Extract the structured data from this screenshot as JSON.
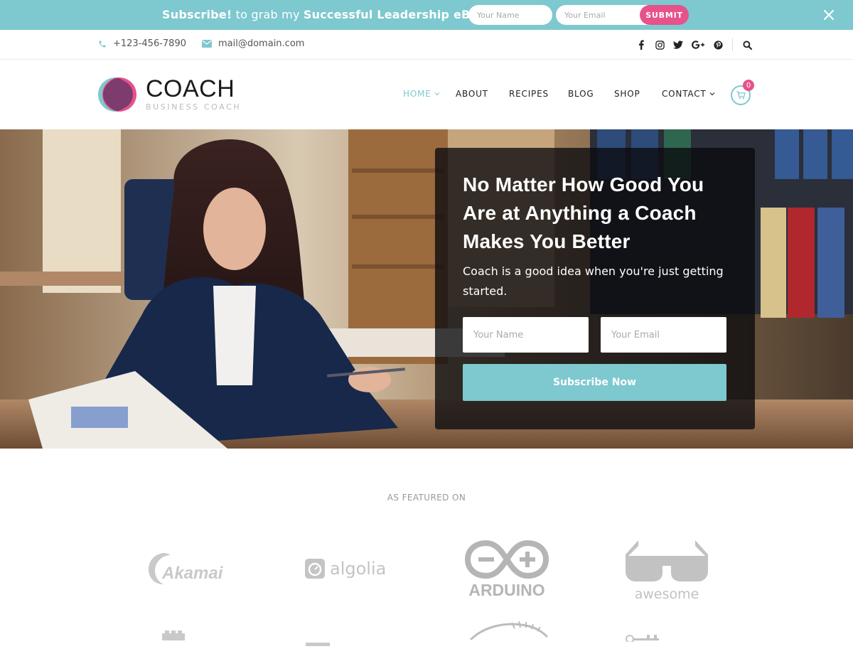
{
  "notify": {
    "text_strong_1": "Subscribe!",
    "text_mid": " to grab my ",
    "text_strong_2": "Successful Leadership eBook!",
    "name_placeholder": "Your Name",
    "email_placeholder": "Your Email",
    "submit_label": "SUBMIT",
    "close_icon": "close-icon",
    "bg_color": "#7ec8cf",
    "submit_color": "#e7528a"
  },
  "contact": {
    "phone": "+123-456-7890",
    "email": "mail@domain.com",
    "social_icons": [
      "facebook-icon",
      "instagram-icon",
      "twitter-icon",
      "google-plus-icon",
      "pinterest-icon"
    ],
    "search_icon": "search-icon"
  },
  "header": {
    "logo_title": "COACH",
    "logo_subtitle": "BUSINESS COACH",
    "nav": [
      {
        "label": "HOME",
        "active": true,
        "has_dropdown": true
      },
      {
        "label": "ABOUT",
        "active": false,
        "has_dropdown": false
      },
      {
        "label": "RECIPES",
        "active": false,
        "has_dropdown": false
      },
      {
        "label": "BLOG",
        "active": false,
        "has_dropdown": false
      },
      {
        "label": "SHOP",
        "active": false,
        "has_dropdown": false
      },
      {
        "label": "CONTACT",
        "active": false,
        "has_dropdown": true
      }
    ],
    "cart_count": "0",
    "accent_color": "#7ec8cf"
  },
  "hero": {
    "title": "No Matter How Good You Are at Anything a Coach Makes You Better",
    "subtitle": "Coach is a good idea when you're just getting started.",
    "name_placeholder": "Your Name",
    "email_placeholder": "Your Email",
    "button_label": "Subscribe Now"
  },
  "featured": {
    "label": "AS FEATURED ON",
    "logos": [
      {
        "name": "Akamai",
        "text": "Akamai"
      },
      {
        "name": "algolia",
        "text": "algolia"
      },
      {
        "name": "ARDUINO",
        "text": "ARDUINO"
      },
      {
        "name": "awesome",
        "text": "awesome"
      }
    ]
  }
}
